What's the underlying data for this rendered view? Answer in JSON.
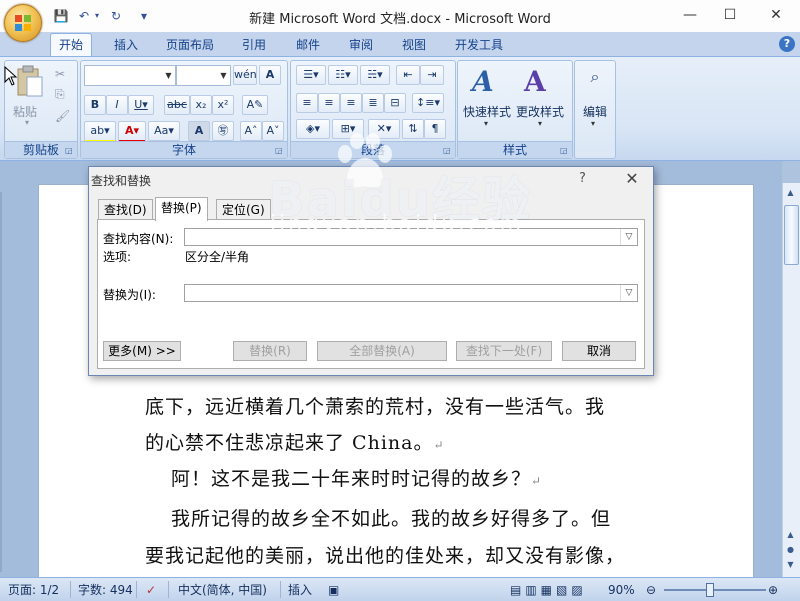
{
  "window": {
    "title": "新建 Microsoft Word 文档.docx - Microsoft Word",
    "minimize": "—",
    "maximize": "☐",
    "close": "✕"
  },
  "qat": {
    "save": "💾",
    "undo": "↶",
    "redo": "↻",
    "customize": "▾"
  },
  "ribbon": {
    "tabs": [
      "开始",
      "插入",
      "页面布局",
      "引用",
      "邮件",
      "审阅",
      "视图",
      "开发工具"
    ],
    "active_tab": "开始",
    "help": "?",
    "groups": {
      "clipboard": {
        "label": "剪贴板",
        "paste": "粘贴"
      },
      "font": {
        "label": "字体"
      },
      "paragraph": {
        "label": "段落"
      },
      "styles": {
        "label": "样式",
        "quick_styles": "快速样式",
        "change_styles": "更改样式"
      },
      "editing": {
        "label": "编辑",
        "button": "编辑"
      }
    }
  },
  "document": {
    "lines": [
      "底下，远近横着几个萧索的荒村，没有一些活气。我",
      "的心禁不住悲凉起来了 China。",
      "阿！这不是我二十年来时时记得的故乡？",
      "我所记得的故乡全不如此。我的故乡好得多了。但",
      "要我记起他的美丽，说出他的佳处来，却又没有影像，"
    ],
    "para_mark": "↵"
  },
  "dialog": {
    "title": "查找和替换",
    "help": "?",
    "close": "✕",
    "tabs": [
      "查找(D)",
      "替换(P)",
      "定位(G)"
    ],
    "active_tab": "替换(P)",
    "find_label": "查找内容(N):",
    "find_value": "",
    "options_label": "选项:",
    "options_value": "区分全/半角",
    "replace_label": "替换为(I):",
    "replace_value": "",
    "buttons": {
      "more": "更多(M) >>",
      "replace": "替换(R)",
      "replace_all": "全部替换(A)",
      "find_next": "查找下一处(F)",
      "cancel": "取消"
    }
  },
  "statusbar": {
    "page": "页面: 1/2",
    "words": "字数: 494",
    "language": "中文(简体, 中国)",
    "mode": "插入",
    "zoom": "90%",
    "zoom_level_percent": 90
  },
  "watermark": {
    "text": "Baidu经验",
    "sub": "jingyan.baidu.com"
  },
  "colors": {
    "ribbon_tab_text": "#15428b",
    "accent": "#3c74c4"
  }
}
